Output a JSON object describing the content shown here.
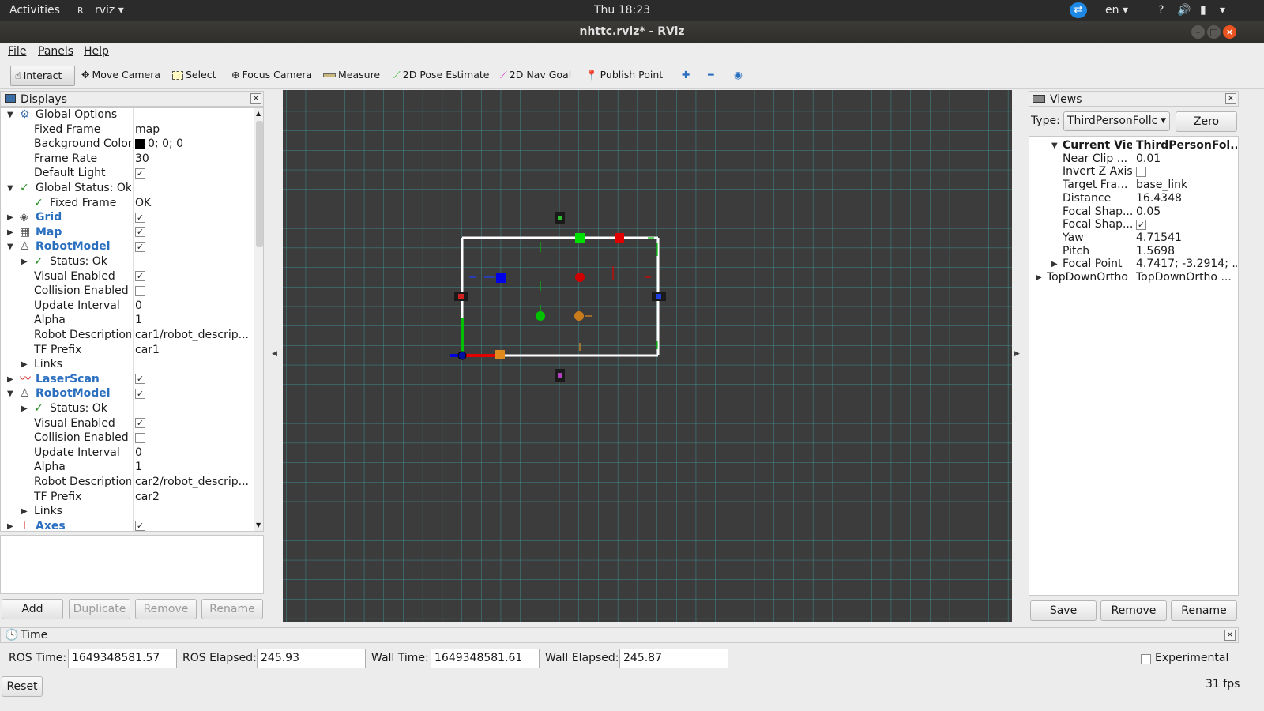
{
  "topbar": {
    "activities": "Activities",
    "app": "rviz",
    "clock": "Thu 18:23",
    "lang": "en"
  },
  "window": {
    "title": "nhttc.rviz* - RViz"
  },
  "menu": {
    "file": "File",
    "panels": "Panels",
    "help": "Help"
  },
  "toolbar": {
    "interact": "Interact",
    "move_camera": "Move Camera",
    "select": "Select",
    "focus_camera": "Focus Camera",
    "measure": "Measure",
    "pose_estimate": "2D Pose Estimate",
    "nav_goal": "2D Nav Goal",
    "publish_point": "Publish Point"
  },
  "displays": {
    "title": "Displays",
    "rows": [
      {
        "label": "Global Options",
        "value": "",
        "expander": "open",
        "icon": "gear-icon",
        "bold": false
      },
      {
        "label": "Fixed Frame",
        "value": "map"
      },
      {
        "label": "Background Color",
        "value": "0; 0; 0",
        "swatch": "#000000"
      },
      {
        "label": "Frame Rate",
        "value": "30"
      },
      {
        "label": "Default Light",
        "value": "",
        "check": "on"
      },
      {
        "label": "Global Status: Ok",
        "value": "",
        "expander": "open",
        "icon": "checkmark-icon"
      },
      {
        "label": "Fixed Frame",
        "value": "OK",
        "icon": "checkmark-icon",
        "sub": true
      },
      {
        "label": "Grid",
        "value": "",
        "check": "on",
        "expander": "closed",
        "icon": "grid-icon",
        "blue": true
      },
      {
        "label": "Map",
        "value": "",
        "check": "on",
        "expander": "closed",
        "icon": "map-icon",
        "blue": true
      },
      {
        "label": "RobotModel",
        "value": "",
        "check": "on",
        "expander": "open",
        "icon": "robot-icon",
        "blue": true
      },
      {
        "label": "Status: Ok",
        "value": "",
        "expander": "closed",
        "icon": "checkmark-icon",
        "sub": true
      },
      {
        "label": "Visual Enabled",
        "value": "",
        "check": "on"
      },
      {
        "label": "Collision Enabled",
        "value": "",
        "check": "off"
      },
      {
        "label": "Update Interval",
        "value": "0"
      },
      {
        "label": "Alpha",
        "value": "1"
      },
      {
        "label": "Robot Description",
        "value": "car1/robot_descrip..."
      },
      {
        "label": "TF Prefix",
        "value": "car1"
      },
      {
        "label": "Links",
        "value": "",
        "expander": "closed",
        "sub": true
      },
      {
        "label": "LaserScan",
        "value": "",
        "check": "on",
        "expander": "closed",
        "icon": "laserscan-icon",
        "blue": true
      },
      {
        "label": "RobotModel",
        "value": "",
        "check": "on",
        "expander": "open",
        "icon": "robot-icon",
        "blue": true
      },
      {
        "label": "Status: Ok",
        "value": "",
        "expander": "closed",
        "icon": "checkmark-icon",
        "sub": true
      },
      {
        "label": "Visual Enabled",
        "value": "",
        "check": "on"
      },
      {
        "label": "Collision Enabled",
        "value": "",
        "check": "off"
      },
      {
        "label": "Update Interval",
        "value": "0"
      },
      {
        "label": "Alpha",
        "value": "1"
      },
      {
        "label": "Robot Description",
        "value": "car2/robot_descrip..."
      },
      {
        "label": "TF Prefix",
        "value": "car2"
      },
      {
        "label": "Links",
        "value": "",
        "expander": "closed",
        "sub": true
      },
      {
        "label": "Axes",
        "value": "",
        "check": "on",
        "expander": "closed",
        "icon": "axes-icon",
        "blue": true
      }
    ],
    "buttons": {
      "add": "Add",
      "duplicate": "Duplicate",
      "remove": "Remove",
      "rename": "Rename"
    }
  },
  "views": {
    "title": "Views",
    "type_label": "Type:",
    "type_value": "ThirdPersonFollc",
    "zero": "Zero",
    "rows": [
      {
        "label": "Current View",
        "value": "ThirdPersonFol...",
        "expander": "open",
        "bold": true
      },
      {
        "label": "Near Clip ...",
        "value": "0.01"
      },
      {
        "label": "Invert Z Axis",
        "value": "",
        "check": "off"
      },
      {
        "label": "Target Fra...",
        "value": "base_link"
      },
      {
        "label": "Distance",
        "value": "16.4348"
      },
      {
        "label": "Focal Shap...",
        "value": "0.05"
      },
      {
        "label": "Focal Shap...",
        "value": "",
        "check": "on"
      },
      {
        "label": "Yaw",
        "value": "4.71541"
      },
      {
        "label": "Pitch",
        "value": "1.5698"
      },
      {
        "label": "Focal Point",
        "value": "4.7417; -3.2914; ...",
        "expander": "closed"
      },
      {
        "label": "TopDownOrtho",
        "value": "TopDownOrtho ...",
        "expander": "closed",
        "top": true
      }
    ],
    "buttons": {
      "save": "Save",
      "remove": "Remove",
      "rename": "Rename"
    }
  },
  "time": {
    "title": "Time",
    "ros_time_label": "ROS Time:",
    "ros_time": "1649348581.57",
    "ros_elapsed_label": "ROS Elapsed:",
    "ros_elapsed": "245.93",
    "wall_time_label": "Wall Time:",
    "wall_time": "1649348581.61",
    "wall_elapsed_label": "Wall Elapsed:",
    "wall_elapsed": "245.87",
    "experimental": "Experimental",
    "reset": "Reset",
    "fps": "31 fps"
  },
  "colors": {
    "grid_line": "#3FA6A6",
    "viewport_bg": "#3C3C3C",
    "accent_blue": "#2A6FC0"
  }
}
